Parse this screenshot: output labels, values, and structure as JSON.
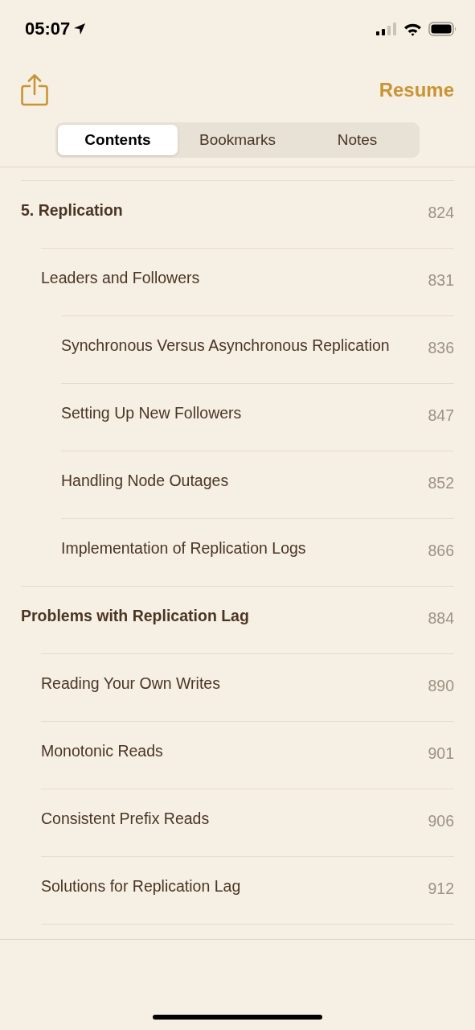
{
  "status_bar": {
    "time": "05:07"
  },
  "nav": {
    "resume": "Resume"
  },
  "tabs": [
    {
      "label": "Contents",
      "selected": true
    },
    {
      "label": "Bookmarks",
      "selected": false
    },
    {
      "label": "Notes",
      "selected": false
    }
  ],
  "contents": [
    {
      "title": "5. Replication",
      "page": "824",
      "children": [
        {
          "title": "Leaders and Followers",
          "page": "831",
          "children": [
            {
              "title": "Synchronous Versus Asynchronous Replication",
              "page": "836"
            },
            {
              "title": "Setting Up New Followers",
              "page": "847"
            },
            {
              "title": "Handling Node Outages",
              "page": "852"
            },
            {
              "title": "Implementation of Replication Logs",
              "page": "866"
            }
          ]
        }
      ]
    },
    {
      "title": "Problems with Replication Lag",
      "page": "884",
      "children": [
        {
          "title": "Reading Your Own Writes",
          "page": "890"
        },
        {
          "title": "Monotonic Reads",
          "page": "901"
        },
        {
          "title": "Consistent Prefix Reads",
          "page": "906"
        },
        {
          "title": "Solutions for Replication Lag",
          "page": "912"
        }
      ]
    }
  ]
}
